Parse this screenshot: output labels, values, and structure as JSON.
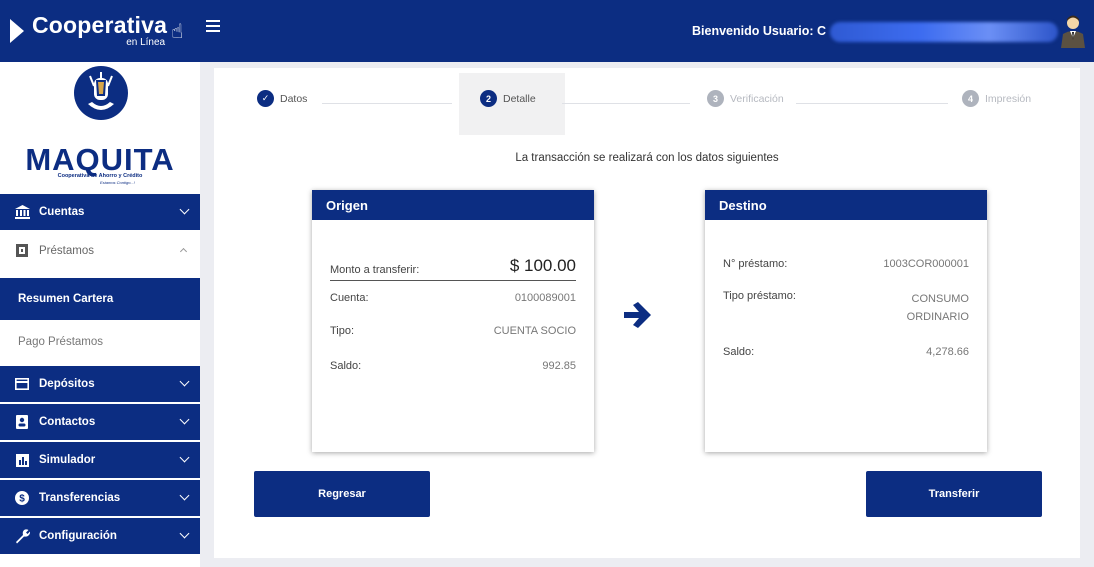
{
  "brand": {
    "name": "Cooperativa",
    "sub": "en Línea"
  },
  "header": {
    "welcome": "Bienvenido Usuario: C"
  },
  "logo": {
    "title": "MAQUITA",
    "subtitle": "Cooperativa de Ahorro y Crédito",
    "tagline": "Estamos Contigo...!"
  },
  "sidebar": {
    "items": [
      {
        "label": "Cuentas",
        "icon": "bank-icon"
      },
      {
        "label": "Préstamos",
        "icon": "loan-icon"
      },
      {
        "label": "Resumen Cartera"
      },
      {
        "label": "Pago Préstamos"
      },
      {
        "label": "Depósitos",
        "icon": "deposit-icon"
      },
      {
        "label": "Contactos",
        "icon": "contacts-icon"
      },
      {
        "label": "Simulador",
        "icon": "simulator-icon"
      },
      {
        "label": "Transferencias",
        "icon": "transfer-icon"
      },
      {
        "label": "Configuración",
        "icon": "wrench-icon"
      }
    ]
  },
  "stepper": {
    "steps": [
      {
        "label": "Datos",
        "marker": "✓",
        "state": "done"
      },
      {
        "label": "Detalle",
        "marker": "2",
        "state": "active"
      },
      {
        "label": "Verificación",
        "marker": "3",
        "state": "pending"
      },
      {
        "label": "Impresión",
        "marker": "4",
        "state": "pending"
      }
    ]
  },
  "info": "La transacción se realizará con los datos siguientes",
  "origen": {
    "title": "Origen",
    "monto_label": "Monto a transferir:",
    "monto_value": "$ 100.00",
    "cuenta_label": "Cuenta:",
    "cuenta_value": "0100089001",
    "tipo_label": "Tipo:",
    "tipo_value": "CUENTA SOCIO",
    "saldo_label": "Saldo:",
    "saldo_value": "992.85"
  },
  "destino": {
    "title": "Destino",
    "prestamo_label": "N° préstamo:",
    "prestamo_value": "1003COR000001",
    "tipo_label": "Tipo préstamo:",
    "tipo_value_1": "CONSUMO",
    "tipo_value_2": "ORDINARIO",
    "saldo_label": "Saldo:",
    "saldo_value": "4,278.66"
  },
  "actions": {
    "back": "Regresar",
    "submit": "Transferir"
  },
  "colors": {
    "primary": "#0c2d82",
    "pending": "#aeb3bd"
  }
}
